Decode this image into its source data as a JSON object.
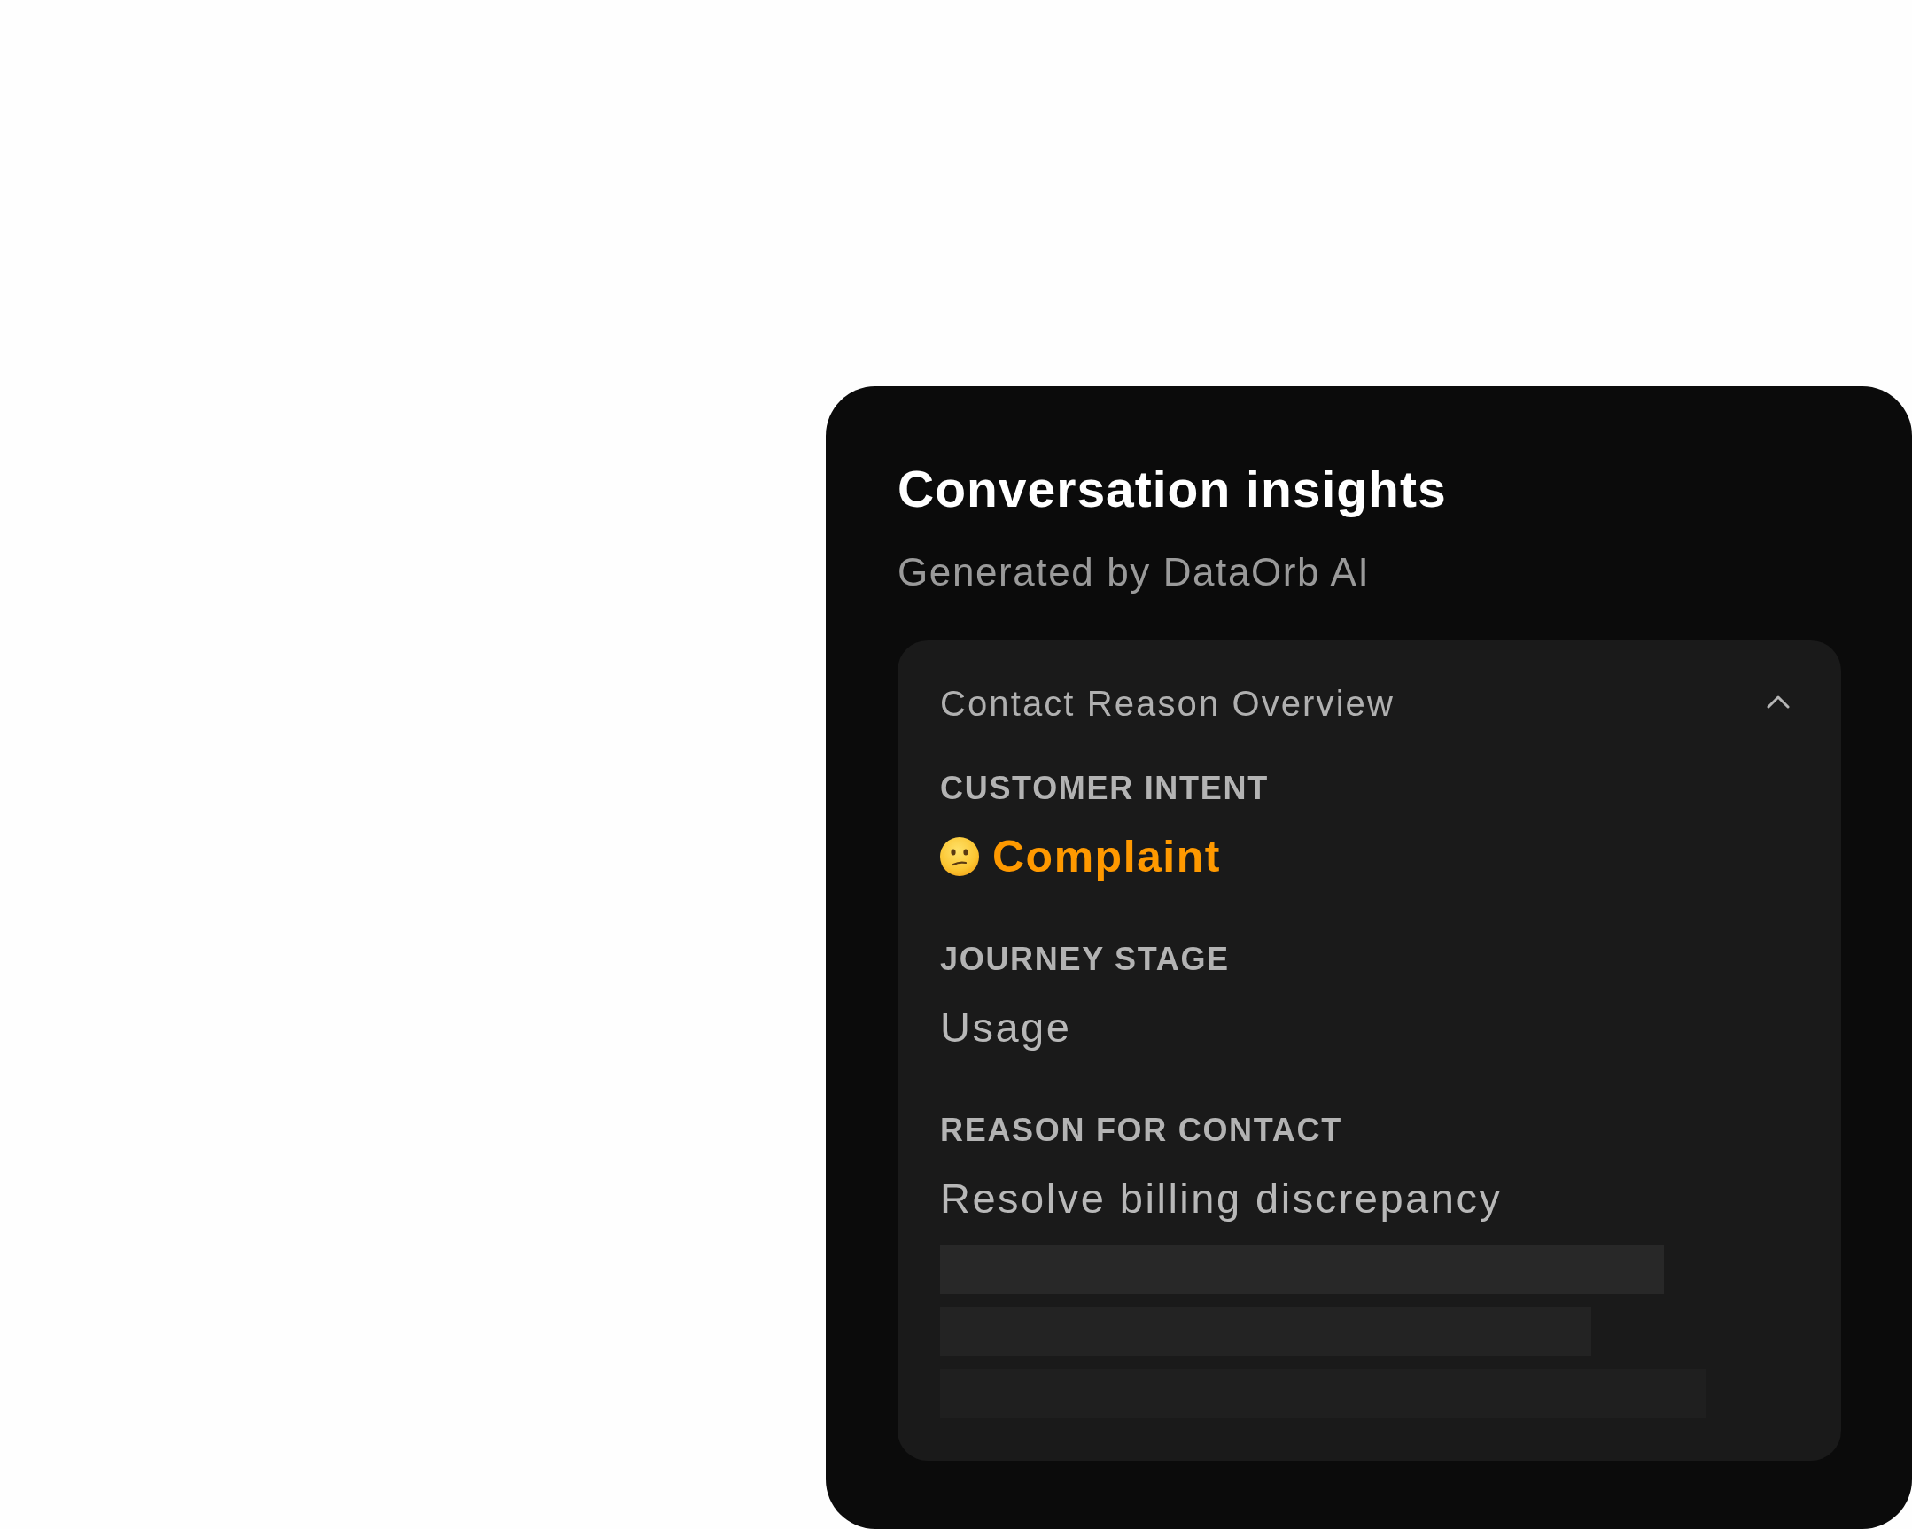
{
  "card": {
    "title": "Conversation insights",
    "subtitle": "Generated by DataOrb AI"
  },
  "panel": {
    "title": "Contact Reason Overview",
    "expanded": true,
    "fields": [
      {
        "kind": "intent",
        "label": "CUSTOMER INTENT",
        "value": "Complaint"
      },
      {
        "kind": "text",
        "label": "JOURNEY STAGE",
        "value": "Usage"
      },
      {
        "kind": "text",
        "label": "REASON FOR CONTACT",
        "value": "Resolve billing discrepancy",
        "loading": true
      }
    ]
  }
}
